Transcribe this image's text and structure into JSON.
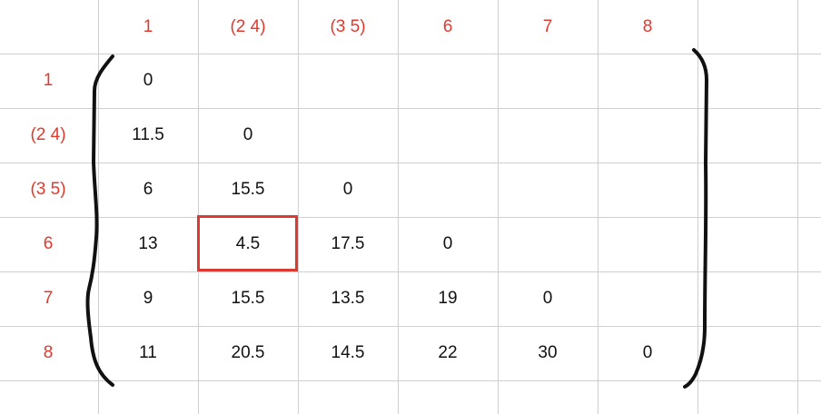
{
  "column_headers": [
    "1",
    "(2 4)",
    "(3 5)",
    "6",
    "7",
    "8"
  ],
  "row_headers": [
    "1",
    "(2 4)",
    "(3 5)",
    "6",
    "7",
    "8"
  ],
  "rows": [
    [
      "0"
    ],
    [
      "11.5",
      "0"
    ],
    [
      "6",
      "15.5",
      "0"
    ],
    [
      "13",
      "4.5",
      "17.5",
      "0"
    ],
    [
      "9",
      "15.5",
      "13.5",
      "19",
      "0"
    ],
    [
      "11",
      "20.5",
      "14.5",
      "22",
      "30",
      "0"
    ]
  ],
  "highlighted_cell": {
    "row": 3,
    "col": 1,
    "value": "4.5"
  },
  "colors": {
    "header_text": "#e03a2f",
    "grid": "#cfcfcf",
    "highlight": "#d93a32",
    "bracket": "#111111"
  }
}
